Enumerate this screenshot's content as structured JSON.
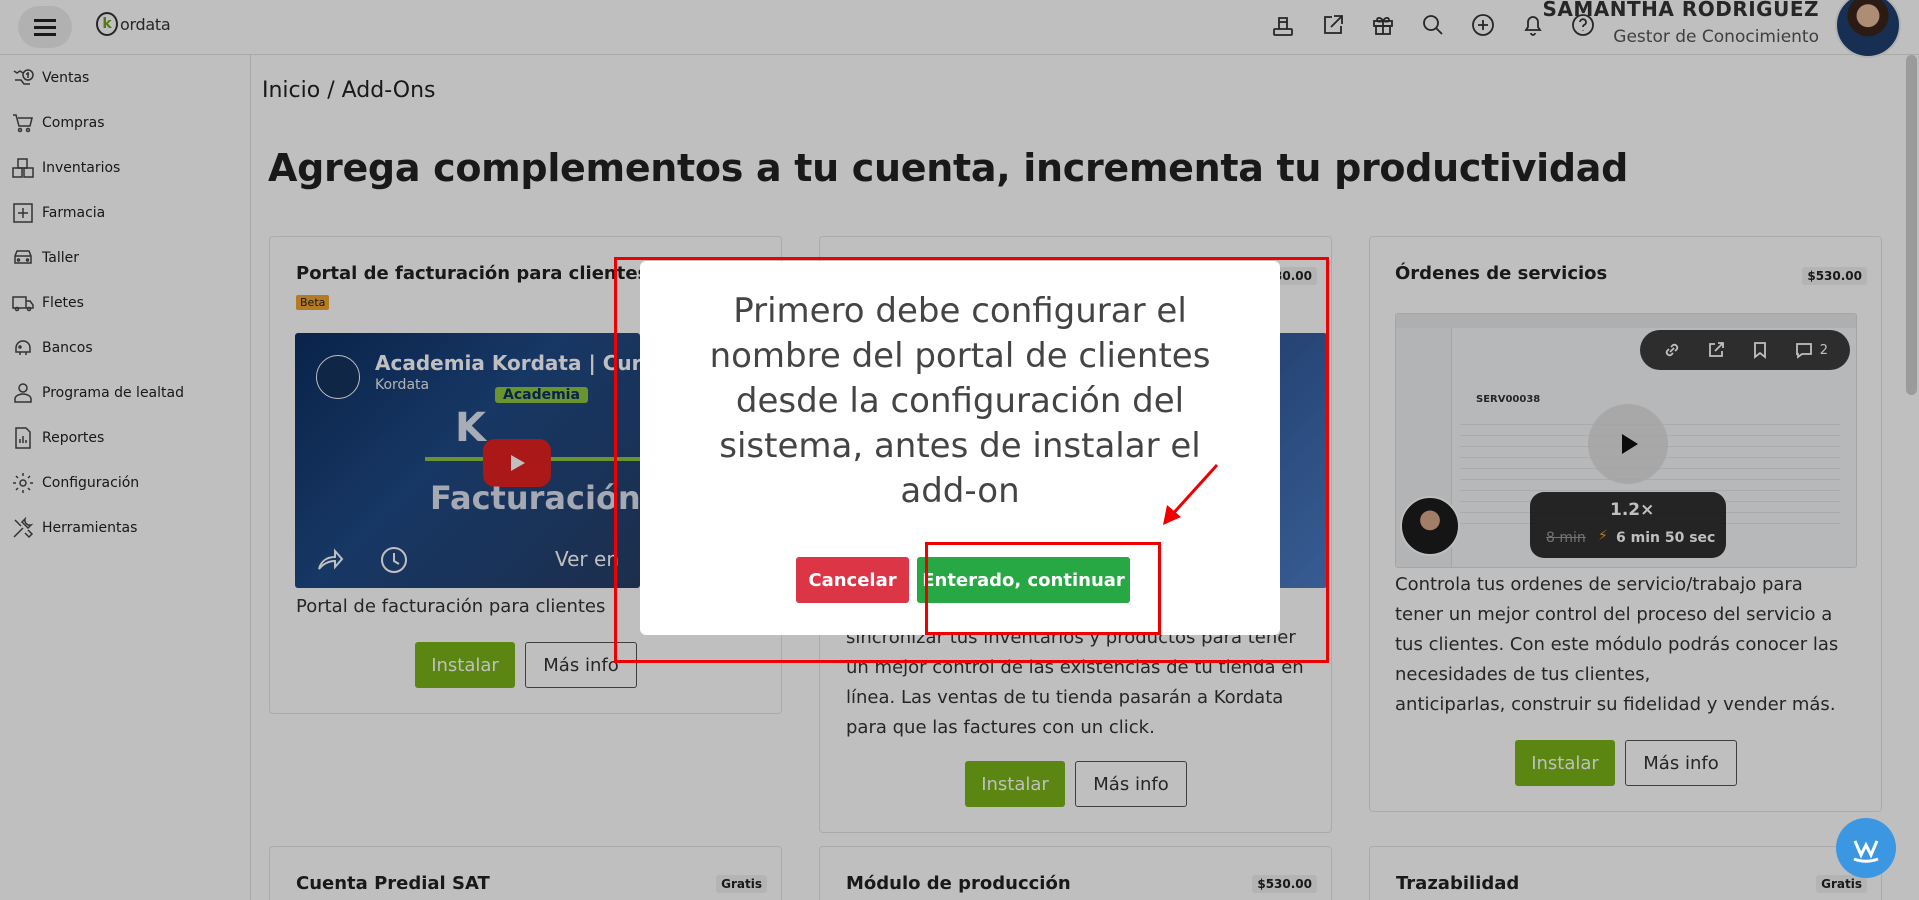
{
  "header": {
    "logo_text": "ordata",
    "logo_letter": "k",
    "user_name": "SAMANTHA RODRIGUEZ",
    "user_role": "Gestor de Conocimiento",
    "icons": [
      "pos-icon",
      "external-link-icon",
      "gift-icon",
      "search-icon",
      "add-icon",
      "bell-icon",
      "help-icon"
    ]
  },
  "sidebar": {
    "items": [
      {
        "label": "Ventas",
        "icon": "sales-icon"
      },
      {
        "label": "Compras",
        "icon": "cart-icon"
      },
      {
        "label": "Inventarios",
        "icon": "inventory-icon"
      },
      {
        "label": "Farmacia",
        "icon": "pharmacy-icon"
      },
      {
        "label": "Taller",
        "icon": "workshop-icon"
      },
      {
        "label": "Fletes",
        "icon": "truck-icon"
      },
      {
        "label": "Bancos",
        "icon": "bank-icon"
      },
      {
        "label": "Programa de lealtad",
        "icon": "loyalty-icon"
      },
      {
        "label": "Reportes",
        "icon": "reports-icon"
      },
      {
        "label": "Configuración",
        "icon": "gear-icon"
      },
      {
        "label": "Herramientas",
        "icon": "tools-icon"
      }
    ]
  },
  "breadcrumb": "Inicio /  Add-Ons",
  "page_title": "Agrega complementos a tu cuenta, incrementa tu productividad",
  "cards": {
    "portal": {
      "title": "Portal de facturación para clientes",
      "badge": "Beta",
      "video_title": "Academia Kordata | Curso",
      "video_channel": "Kordata",
      "video_overlay_text": "Facturación",
      "video_academy_tag": "Academia",
      "video_watch_text": "Ver en",
      "description": "Portal de facturación para clientes",
      "install_label": "Instalar",
      "info_label": "Más info"
    },
    "tienda": {
      "price": "$530.00",
      "description_lines": [
        "sincronizar tus inventarios y productos para tener",
        "un mejor control de las existencias de tu tienda en",
        "línea. Las ventas de tu tienda pasarán a Kordata",
        "para que las factures con un click."
      ],
      "install_label": "Instalar",
      "info_label": "Más info"
    },
    "ordenes": {
      "title": "Órdenes de servicios",
      "price": "$530.00",
      "video_doc_code": "SERV00038",
      "video_speed": "1.2×",
      "video_old_time": "8 min",
      "video_new_time": "6 min 50 sec",
      "video_comments": "2",
      "description_lines": [
        "Controla tus ordenes de servicio/trabajo para",
        "tener un mejor control del proceso del servicio a",
        "tus clientes. Con este módulo podrás conocer las",
        "necesidades de tus clientes,",
        "anticiparlas, construir su fidelidad y vender más."
      ],
      "install_label": "Instalar",
      "info_label": "Más info"
    },
    "predial": {
      "title": "Cuenta Predial SAT",
      "price": "Gratis"
    },
    "produccion": {
      "title": "Módulo de producción",
      "price": "$530.00"
    },
    "trazabilidad": {
      "title": "Trazabilidad",
      "price": "Gratis"
    }
  },
  "modal": {
    "message": "Primero debe configurar el nombre del portal de clientes desde la configuración del sistema, antes de instalar el add-on",
    "cancel_label": "Cancelar",
    "continue_label": "Enterado, continuar"
  },
  "colors": {
    "install_green": "#7ab317",
    "continue_green": "#28a745",
    "cancel_red": "#dc3545",
    "annotation_red": "#e00000",
    "beta_orange": "#f0a331"
  }
}
